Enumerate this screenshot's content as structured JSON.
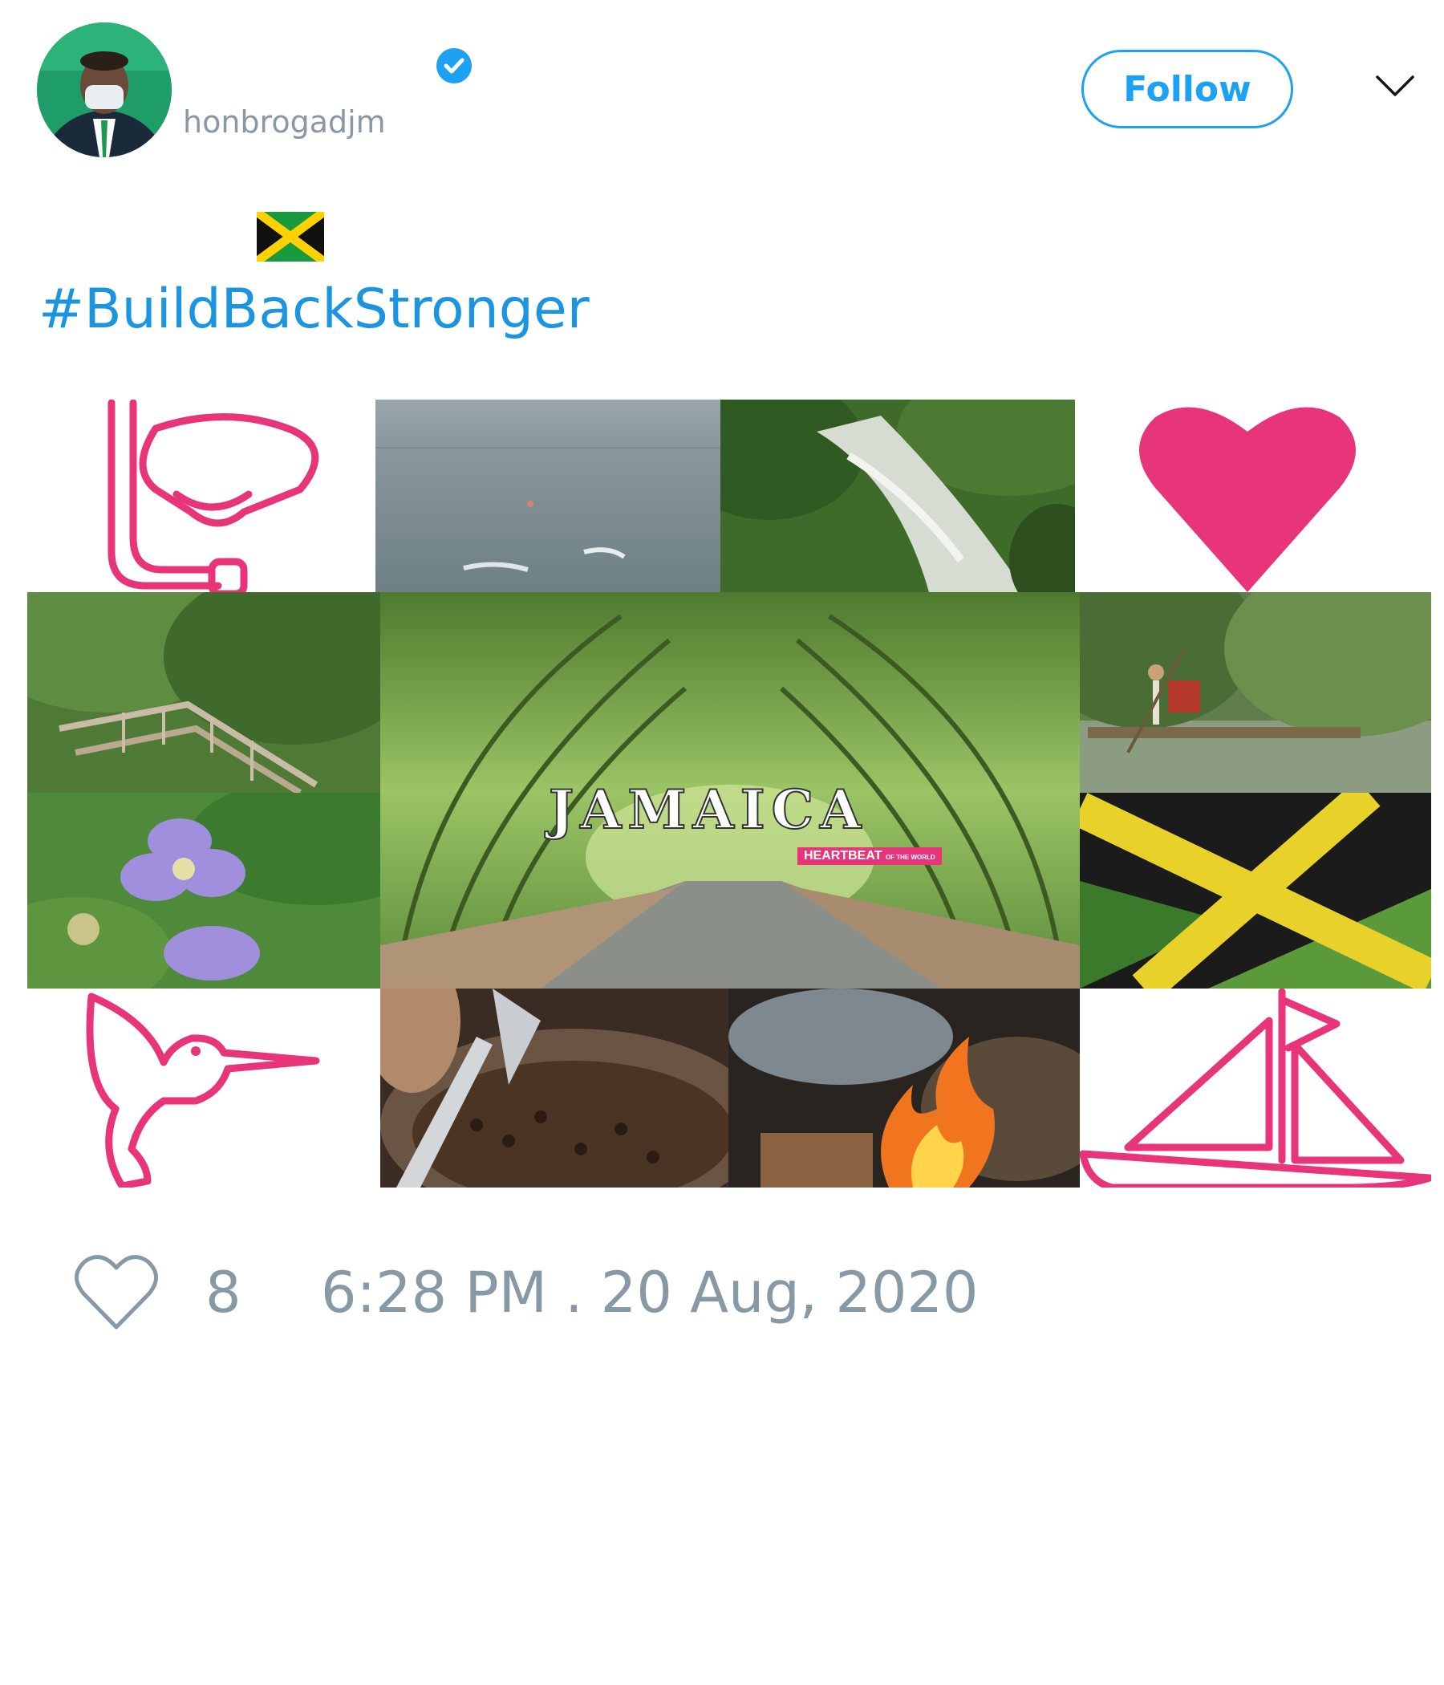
{
  "user": {
    "handle": "honbrogadjm",
    "verified": true
  },
  "follow_button": {
    "label": "Follow"
  },
  "tweet": {
    "flag_emoji": "jamaica-flag",
    "hashtag": "#BuildBackStronger"
  },
  "media": {
    "overlay_title": "JAMAICA",
    "overlay_tagline": "HEARTBEAT",
    "overlay_tagline_small": "OF THE WORLD"
  },
  "actions": {
    "like_count": "8",
    "timestamp": "6:28 PM . 20 Aug, 2020"
  },
  "colors": {
    "brand_blue": "#1da1f2",
    "muted": "#8899a6",
    "pink": "#e8357a"
  }
}
